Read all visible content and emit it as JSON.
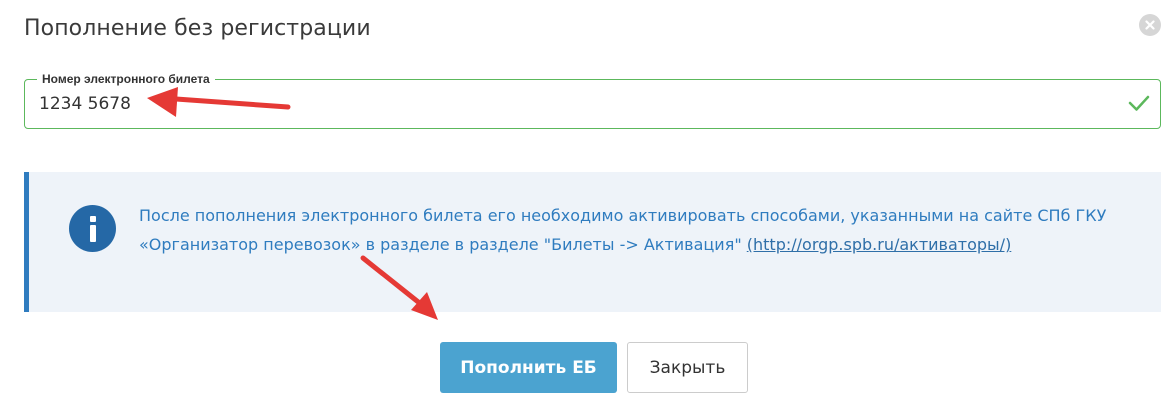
{
  "modal": {
    "title": "Пополнение без регистрации"
  },
  "ticket_field": {
    "legend": "Номер электронного билета",
    "value": "1234 5678",
    "valid": true
  },
  "info": {
    "text": "После пополнения электронного билета его необходимо активировать способами, указанными на сайте СПб ГКУ «Организатор перевозок» в разделе в разделе \"Билеты -> Активация\" ",
    "link": "(http://orgp.spb.ru/активаторы/)"
  },
  "buttons": {
    "submit_label": "Пополнить ЕБ",
    "close_label": "Закрыть"
  },
  "colors": {
    "accent": "#2f7cbf",
    "success": "#5cb85c",
    "primary_button": "#4ba3d0",
    "annotation_arrow": "#e53935"
  },
  "icons": {
    "close": "close-icon",
    "check": "check-icon",
    "info": "info-icon",
    "arrow": "annotation-arrow"
  }
}
